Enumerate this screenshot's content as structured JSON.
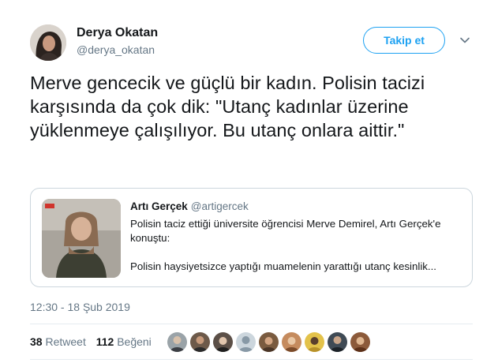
{
  "author": {
    "name": "Derya Okatan",
    "handle": "@derya_okatan"
  },
  "follow_button": "Takip et",
  "tweet_text": "Merve gencecik ve güçlü bir kadın. Polisin tacizi karşısında da çok dik: \"Utanç kadınlar üzerine yüklenmeye çalışılıyor. Bu utanç onlara aittir.\"",
  "quote": {
    "name": "Artı Gerçek",
    "handle": "@artigercek",
    "text_line1": "Polisin taciz ettiği üniversite öğrencisi Merve Demirel, Artı Gerçek'e konuştu:",
    "text_line2": "Polisin haysiyetsizce yaptığı muamelenin yarattığı utanç kesinlik..."
  },
  "timestamp": "12:30 - 18 Şub 2019",
  "stats": {
    "retweet_count": "38",
    "retweet_label": "Retweet",
    "like_count": "112",
    "like_label": "Beğeni"
  },
  "colors": {
    "accent": "#1da1f2",
    "secondary_text": "#657786",
    "border": "#ccd6dd"
  }
}
